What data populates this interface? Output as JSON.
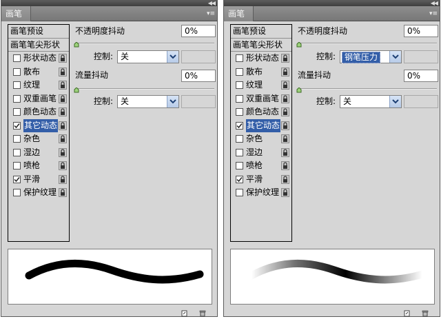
{
  "panels": [
    {
      "tab_title": "画笔",
      "presets_label": "画笔预设",
      "tip_shape_label": "画笔笔尖形状",
      "items": [
        {
          "label": "形状动态",
          "checked": false,
          "selected": false
        },
        {
          "label": "散布",
          "checked": false,
          "selected": false
        },
        {
          "label": "纹理",
          "checked": false,
          "selected": false
        },
        {
          "label": "双重画笔",
          "checked": false,
          "selected": false
        },
        {
          "label": "颜色动态",
          "checked": false,
          "selected": false
        },
        {
          "label": "其它动态",
          "checked": true,
          "selected": true
        },
        {
          "label": "杂色",
          "checked": false,
          "selected": false
        },
        {
          "label": "湿边",
          "checked": false,
          "selected": false
        },
        {
          "label": "喷枪",
          "checked": false,
          "selected": false
        },
        {
          "label": "平滑",
          "checked": true,
          "selected": false
        },
        {
          "label": "保护纹理",
          "checked": false,
          "selected": false
        }
      ],
      "opacity_jitter_label": "不透明度抖动",
      "opacity_jitter_value": "0%",
      "opacity_control_label": "控制:",
      "opacity_control_value": "关",
      "flow_jitter_label": "流量抖动",
      "flow_jitter_value": "0%",
      "flow_control_label": "控制:",
      "flow_control_value": "关",
      "stroke_style": "solid"
    },
    {
      "tab_title": "画笔",
      "presets_label": "画笔预设",
      "tip_shape_label": "画笔笔尖形状",
      "items": [
        {
          "label": "形状动态",
          "checked": false,
          "selected": false
        },
        {
          "label": "散布",
          "checked": false,
          "selected": false
        },
        {
          "label": "纹理",
          "checked": false,
          "selected": false
        },
        {
          "label": "双重画笔",
          "checked": false,
          "selected": false
        },
        {
          "label": "颜色动态",
          "checked": false,
          "selected": false
        },
        {
          "label": "其它动态",
          "checked": true,
          "selected": true
        },
        {
          "label": "杂色",
          "checked": false,
          "selected": false
        },
        {
          "label": "湿边",
          "checked": false,
          "selected": false
        },
        {
          "label": "喷枪",
          "checked": false,
          "selected": false
        },
        {
          "label": "平滑",
          "checked": true,
          "selected": false
        },
        {
          "label": "保护纹理",
          "checked": false,
          "selected": false
        }
      ],
      "opacity_jitter_label": "不透明度抖动",
      "opacity_jitter_value": "0%",
      "opacity_control_label": "控制:",
      "opacity_control_value": "钢笔压力",
      "flow_jitter_label": "流量抖动",
      "flow_jitter_value": "0%",
      "flow_control_label": "控制:",
      "flow_control_value": "关",
      "stroke_style": "fade"
    }
  ],
  "colors": {
    "selection": "#335ea8",
    "panel_bg": "#d6d6d6",
    "tab_bar": "#808080"
  },
  "icons": [
    "collapse-arrows-icon",
    "panel-menu-icon",
    "lock-icon",
    "checkmark-icon",
    "chevron-down-icon",
    "new-brush-icon",
    "trash-icon"
  ]
}
